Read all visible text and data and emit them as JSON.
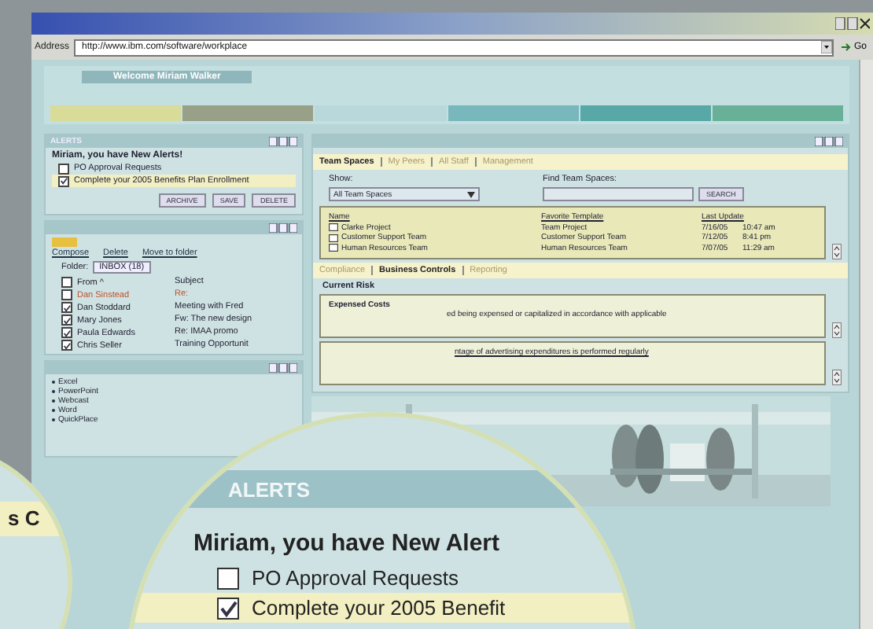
{
  "browser": {
    "address_label": "Address",
    "url": "http://www.ibm.com/software/workplace",
    "go": "Go"
  },
  "banner": {
    "welcome": "Welcome Miriam Walker",
    "nav_bars": [
      {
        "color": "#d8dc98"
      },
      {
        "color": "#98a088"
      },
      {
        "color": "#b8d8dc"
      },
      {
        "color": "#78b8bc"
      },
      {
        "color": "#58a8a8"
      },
      {
        "color": "#68b098"
      }
    ]
  },
  "alerts_panel": {
    "title": "ALERTS",
    "heading": "Miriam, you have New Alerts!",
    "items": [
      {
        "label": "PO Approval Requests",
        "checked": false,
        "highlighted": false
      },
      {
        "label": "Complete your 2005 Benefits Plan Enrollment",
        "checked": true,
        "highlighted": true
      }
    ],
    "buttons": [
      "ARCHIVE",
      "SAVE",
      "DELETE"
    ]
  },
  "mail_panel": {
    "links": [
      "Compose",
      "Delete",
      "Move to folder"
    ],
    "folder_label": "Folder:",
    "folder": "INBOX (18)",
    "columns": [
      "From ^",
      "Subject"
    ],
    "header_checked": false,
    "rows": [
      {
        "from": "Dan Sinstead",
        "subject": "Re:",
        "checked": false,
        "unread": true
      },
      {
        "from": "Dan Stoddard",
        "subject": "Meeting with Fred",
        "checked": true,
        "unread": false
      },
      {
        "from": "Mary Jones",
        "subject": "Fw: The new design",
        "checked": true,
        "unread": false
      },
      {
        "from": "Paula Edwards",
        "subject": "Re: IMAA promo",
        "checked": true,
        "unread": false
      },
      {
        "from": "Chris Seller",
        "subject": "Training Opportunit",
        "checked": true,
        "unread": false
      }
    ]
  },
  "apps_panel": {
    "items": [
      "Excel",
      "PowerPoint",
      "Webcast",
      "Word",
      "QuickPlace"
    ]
  },
  "team_panel": {
    "tabs": [
      {
        "label": "Team Spaces",
        "selected": true
      },
      {
        "label": "My Peers",
        "selected": false
      },
      {
        "label": "All Staff",
        "selected": false
      },
      {
        "label": "Management",
        "selected": false
      }
    ],
    "show_label": "Show:",
    "show_value": "All Team Spaces",
    "find_label": "Find Team Spaces:",
    "search_button": "SEARCH",
    "columns": [
      "Name",
      "Favorite Template",
      "Last Update"
    ],
    "rows": [
      {
        "name": "Clarke Project",
        "template": "Team Project",
        "date": "7/16/05",
        "time": "10:47 am"
      },
      {
        "name": "Customer Support Team",
        "template": "Customer Support Team",
        "date": "7/12/05",
        "time": "8:41 pm"
      },
      {
        "name": "Human Resources Team",
        "template": "Human Resources Team",
        "date": "7/07/05",
        "time": "11:29 am"
      }
    ]
  },
  "controls_panel": {
    "tabs": [
      {
        "label": "Compliance",
        "selected": false
      },
      {
        "label": "Business Controls",
        "selected": true
      },
      {
        "label": "Reporting",
        "selected": false
      }
    ],
    "section": "Current Risk",
    "risks": [
      {
        "title": "Expensed Costs",
        "text": "ed being expensed or capitalized in accordance with applicable"
      },
      {
        "link": "ntage of advertising expenditures is performed regularly"
      }
    ]
  },
  "magnifier": {
    "title": "ALERTS",
    "heading": "Miriam, you have New Alert",
    "items": [
      {
        "label": "PO Approval Requests",
        "checked": false,
        "highlighted": false
      },
      {
        "label": "Complete your 2005 Benefit",
        "checked": true,
        "highlighted": true
      }
    ]
  },
  "side_lens": {
    "text": "s C"
  }
}
